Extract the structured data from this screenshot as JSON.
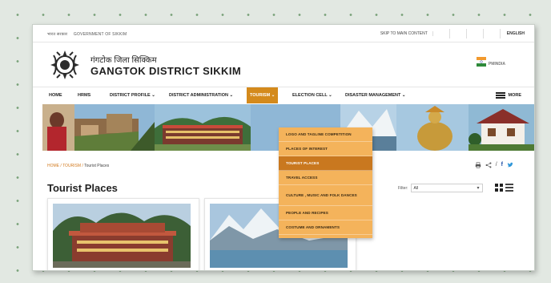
{
  "topbar": {
    "gov_hindi": "भारत सरकार",
    "gov_english": "GOVERNMENT OF SIKKIM",
    "skip": "SKIP TO MAIN CONTENT",
    "language": "ENGLISH"
  },
  "site": {
    "title_hindi": "गंगटोक जिला सिक्किम",
    "title_english": "GANGTOK DISTRICT SIKKIM",
    "partner_logo": "PMINDIA"
  },
  "nav": {
    "items": [
      {
        "label": "HOME"
      },
      {
        "label": "HRMS"
      },
      {
        "label": "DISTRICT PROFILE ⌄"
      },
      {
        "label": "DISTRICT ADMINISTRATION ⌄"
      },
      {
        "label": "TOURISM ⌄"
      },
      {
        "label": "ELECTION CELL ⌄"
      },
      {
        "label": "DISASTER MANAGEMENT ⌄"
      }
    ],
    "more": "MORE",
    "active_color": "#d48a1c"
  },
  "tourism_menu": {
    "items": [
      {
        "label": "LOGO AND TAGLINE COMPETITION"
      },
      {
        "label": "PLACES OF INTEREST"
      },
      {
        "label": "TOURIST PLACES"
      },
      {
        "label": "TRAVEL ACCESS"
      },
      {
        "label": "CULTURE , MUSIC AND FOLK DANCES"
      },
      {
        "label": "PEOPLE AND RECIPES"
      },
      {
        "label": "COSTUME AND ORNAMENTS"
      }
    ],
    "active_index": 2,
    "bg_color": "#f4b35b"
  },
  "breadcrumb": {
    "home": "HOME",
    "section": "TOURISM",
    "current": "Tourist Places",
    "sep": "/"
  },
  "page": {
    "title": "Tourist Places",
    "filter_label": "Filter:",
    "filter_value": "All"
  },
  "icons": {
    "search": "search-icon",
    "accessibility": "accessibility-icon",
    "sitemap": "sitemap-icon",
    "font_size": "font-size-icon",
    "print": "print-icon",
    "share": "share-icon",
    "facebook": "facebook-icon",
    "twitter": "twitter-icon",
    "grid_view": "grid-view-icon",
    "list_view": "list-view-icon"
  }
}
